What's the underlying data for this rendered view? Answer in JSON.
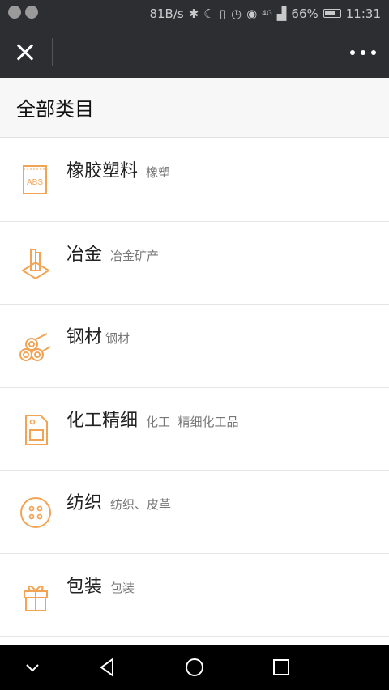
{
  "status_bar": {
    "speed": "81B/s",
    "signal": "4G",
    "battery": "66%",
    "time": "11:31"
  },
  "page": {
    "title": "全部类目"
  },
  "categories": [
    {
      "name": "橡胶塑料",
      "sub": "橡塑",
      "icon": "abs-sheet-icon"
    },
    {
      "name": "冶金",
      "sub": "冶金矿产",
      "icon": "metal-ingot-icon"
    },
    {
      "name": "钢材",
      "sub": "钢材",
      "icon": "steel-pipes-icon"
    },
    {
      "name": "化工精细",
      "sub": "化工  精细化工品",
      "icon": "chemical-bag-icon"
    },
    {
      "name": "纺织",
      "sub": "纺织、皮革",
      "icon": "button-icon"
    },
    {
      "name": "包装",
      "sub": "包装",
      "icon": "gift-box-icon"
    }
  ],
  "accent_color": "#f3a354"
}
